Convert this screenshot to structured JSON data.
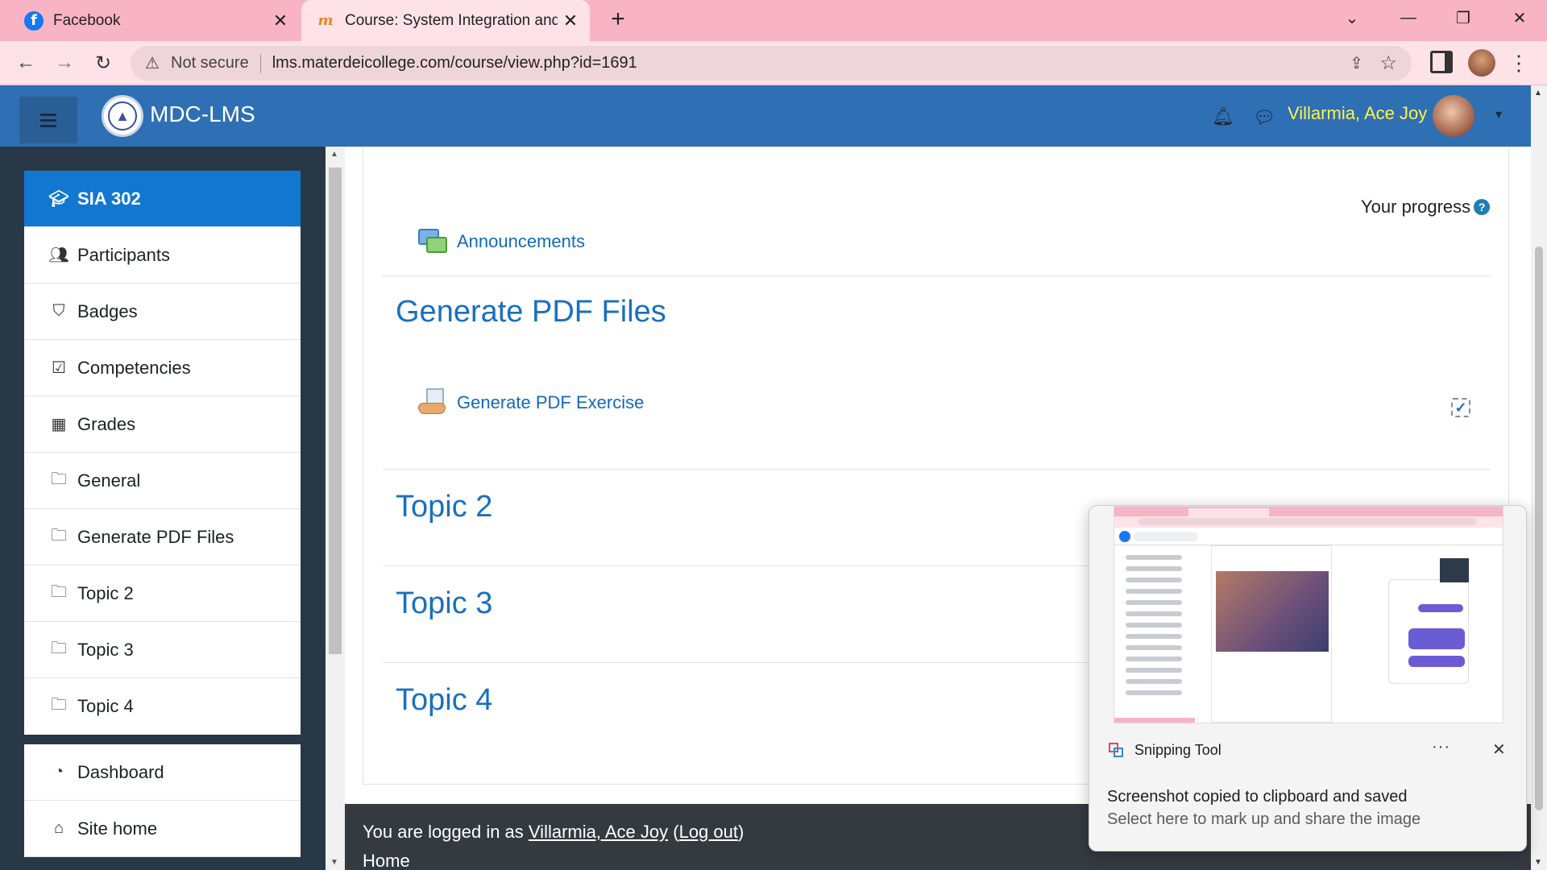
{
  "browser": {
    "tabs": [
      {
        "title": "Facebook",
        "active": false
      },
      {
        "title": "Course: System Integration and A",
        "active": true
      }
    ],
    "new_tab": "+",
    "address": {
      "security": "Not secure",
      "url": "lms.materdeicollege.com/course/view.php?id=1691"
    }
  },
  "navbar": {
    "brand": "MDC-LMS",
    "user_name": "Villarmia, Ace Joy"
  },
  "drawer": {
    "course": {
      "label": "SIA 302",
      "icon": "graduation-cap-icon"
    },
    "items": [
      {
        "label": "Participants",
        "icon": "users-icon"
      },
      {
        "label": "Badges",
        "icon": "shield-icon"
      },
      {
        "label": "Competencies",
        "icon": "check-square-icon"
      },
      {
        "label": "Grades",
        "icon": "table-icon"
      },
      {
        "label": "General",
        "icon": "folder-icon"
      },
      {
        "label": "Generate PDF Files",
        "icon": "folder-icon"
      },
      {
        "label": "Topic 2",
        "icon": "folder-icon"
      },
      {
        "label": "Topic 3",
        "icon": "folder-icon"
      },
      {
        "label": "Topic 4",
        "icon": "folder-icon"
      }
    ],
    "items2": [
      {
        "label": "Dashboard",
        "icon": "dashboard-icon"
      },
      {
        "label": "Site home",
        "icon": "home-icon"
      }
    ]
  },
  "main": {
    "progress_label": "Your progress",
    "announcements": "Announcements",
    "sections": [
      {
        "title": "Generate PDF Files",
        "activity": "Generate PDF Exercise"
      },
      {
        "title": "Topic 2"
      },
      {
        "title": "Topic 3"
      },
      {
        "title": "Topic 4"
      }
    ]
  },
  "footer": {
    "prefix": "You are logged in as ",
    "user": "Villarmia, Ace Joy",
    "open_paren": " (",
    "logout": "Log out",
    "close_paren": ")",
    "home": "Home"
  },
  "toast": {
    "app_name": "Snipping Tool",
    "more": "···",
    "close": "✕",
    "message": "Screenshot copied to clipboard and saved",
    "sub": "Select here to mark up and share the image"
  },
  "colors": {
    "tabbar": "#f8b4c4",
    "navbar": "#2f6fb3",
    "drawer": "#293847",
    "course_active": "#1177d1",
    "link": "#1369b8",
    "user_name": "#fff34d"
  }
}
